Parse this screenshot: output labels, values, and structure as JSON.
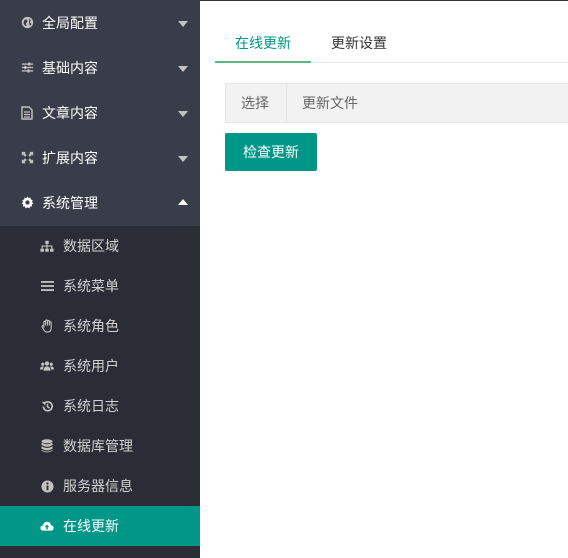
{
  "sidebar": {
    "menu": [
      {
        "label": "全局配置",
        "icon": "globe-icon",
        "state": "collapsed"
      },
      {
        "label": "基础内容",
        "icon": "sliders-icon",
        "state": "collapsed"
      },
      {
        "label": "文章内容",
        "icon": "document-icon",
        "state": "collapsed"
      },
      {
        "label": "扩展内容",
        "icon": "expand-icon",
        "state": "collapsed"
      },
      {
        "label": "系统管理",
        "icon": "gear-icon",
        "state": "expanded"
      }
    ],
    "submenu": [
      {
        "label": "数据区域",
        "icon": "sitemap-icon"
      },
      {
        "label": "系统菜单",
        "icon": "list-icon"
      },
      {
        "label": "系统角色",
        "icon": "hand-icon"
      },
      {
        "label": "系统用户",
        "icon": "users-icon"
      },
      {
        "label": "系统日志",
        "icon": "history-icon"
      },
      {
        "label": "数据库管理",
        "icon": "database-icon"
      },
      {
        "label": "服务器信息",
        "icon": "info-icon"
      },
      {
        "label": "在线更新",
        "icon": "cloud-upload-icon",
        "active": true
      }
    ]
  },
  "main": {
    "tabs": [
      {
        "label": "在线更新",
        "active": true
      },
      {
        "label": "更新设置",
        "active": false
      }
    ],
    "table": {
      "columns": [
        "选择",
        "更新文件"
      ]
    },
    "check_button": "检查更新"
  },
  "colors": {
    "sidebar_bg": "#393d49",
    "submenu_bg": "#2a2d36",
    "accent": "#009688",
    "tab_underline": "#5fb878"
  }
}
